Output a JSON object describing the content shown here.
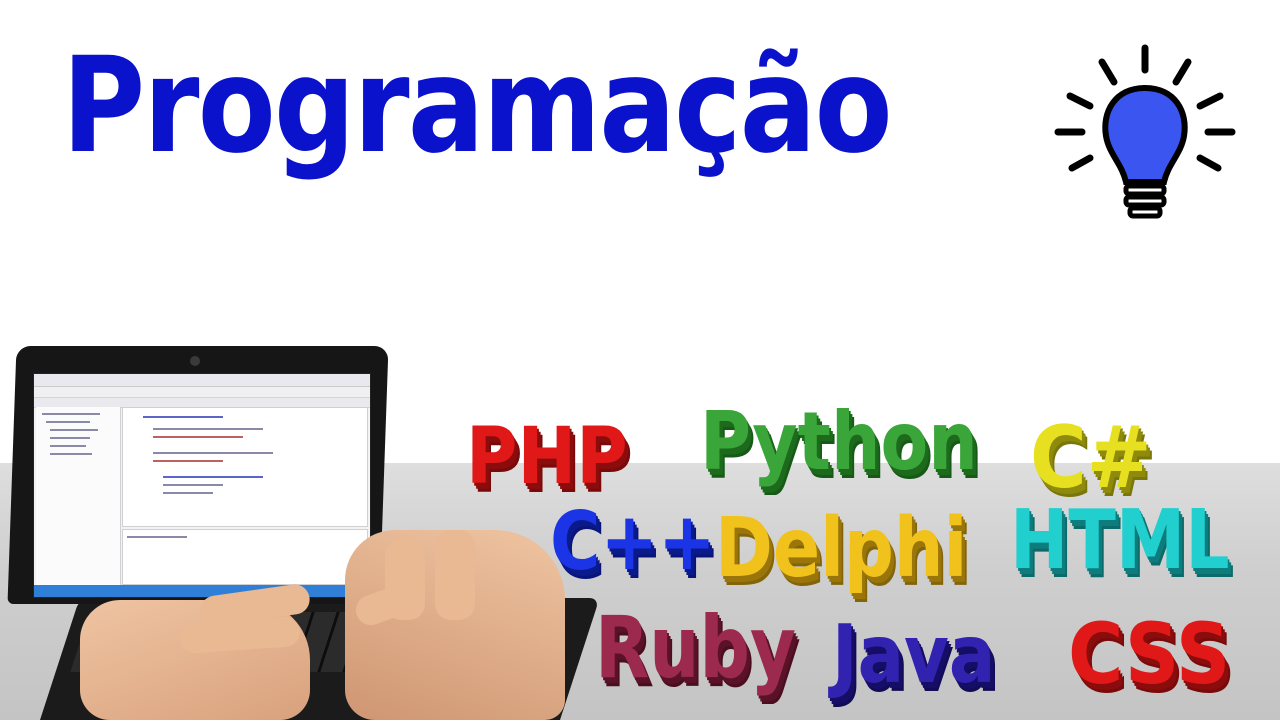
{
  "title": "Programação",
  "icons": {
    "lightbulb": "lightbulb-icon",
    "laptop": "laptop-image"
  },
  "colors": {
    "title": "#0a12cc",
    "bulb": "#3a55f0",
    "php": "#e01818",
    "python": "#3aa63a",
    "csharp": "#e6e020",
    "cpp": "#1a34e6",
    "delphi": "#f2c21c",
    "html": "#22cfcf",
    "ruby": "#9c2a4e",
    "java": "#3222b0",
    "css": "#e01818"
  },
  "languages": {
    "php": "PHP",
    "python": "Python",
    "csharp": "C#",
    "cpp": "C++",
    "delphi": "Delphi",
    "html": "HTML",
    "ruby": "Ruby",
    "java": "Java",
    "css": "CSS"
  }
}
